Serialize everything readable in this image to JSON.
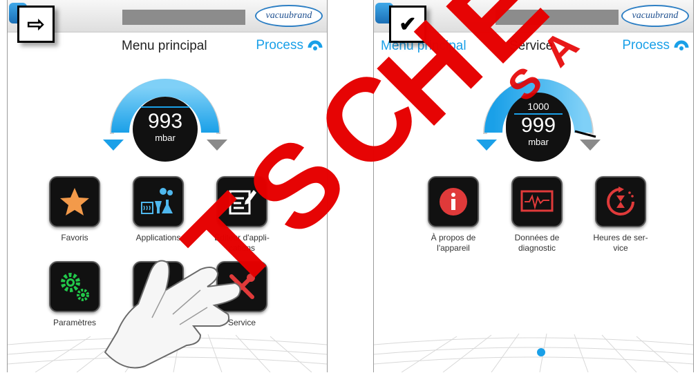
{
  "left_screen": {
    "step_symbol": "⇨",
    "title": "Menu principal",
    "process_label": "Process",
    "logo_text": "vacuubrand",
    "gauge": {
      "value": "993",
      "unit": "mbar"
    },
    "tiles": [
      {
        "label": "Favoris",
        "icon": "star-icon"
      },
      {
        "label": "Applications",
        "icon": "applications-icon"
      },
      {
        "label": "Éditeur d'appli-\ncations",
        "icon": "editor-icon"
      },
      {
        "label": "Paramètres",
        "icon": "gears-icon"
      },
      {
        "label": "",
        "icon": "hidden-icon"
      },
      {
        "label": "Service",
        "icon": "tools-icon"
      }
    ]
  },
  "right_screen": {
    "step_symbol": "✔",
    "back_label": "Menu principal",
    "title": "Service",
    "process_label": "Process",
    "logo_text": "vacuubrand",
    "gauge": {
      "setpoint": "1000",
      "value": "999",
      "unit": "mbar"
    },
    "tiles": [
      {
        "label": "À propos de\nl'appareil",
        "icon": "info-icon"
      },
      {
        "label": "Données de\ndiagnostic",
        "icon": "diagnostic-icon"
      },
      {
        "label": "Heures de ser-\nvice",
        "icon": "service-hours-icon"
      }
    ]
  },
  "watermark_text": "VACUUBRAND SAMPLE VORSCHAU DEUTSCHES",
  "colors": {
    "accent": "#1aa0e8",
    "tile_bg": "#111111",
    "danger": "#e03a3a",
    "green": "#22c84a",
    "watermark": "#e60000"
  }
}
